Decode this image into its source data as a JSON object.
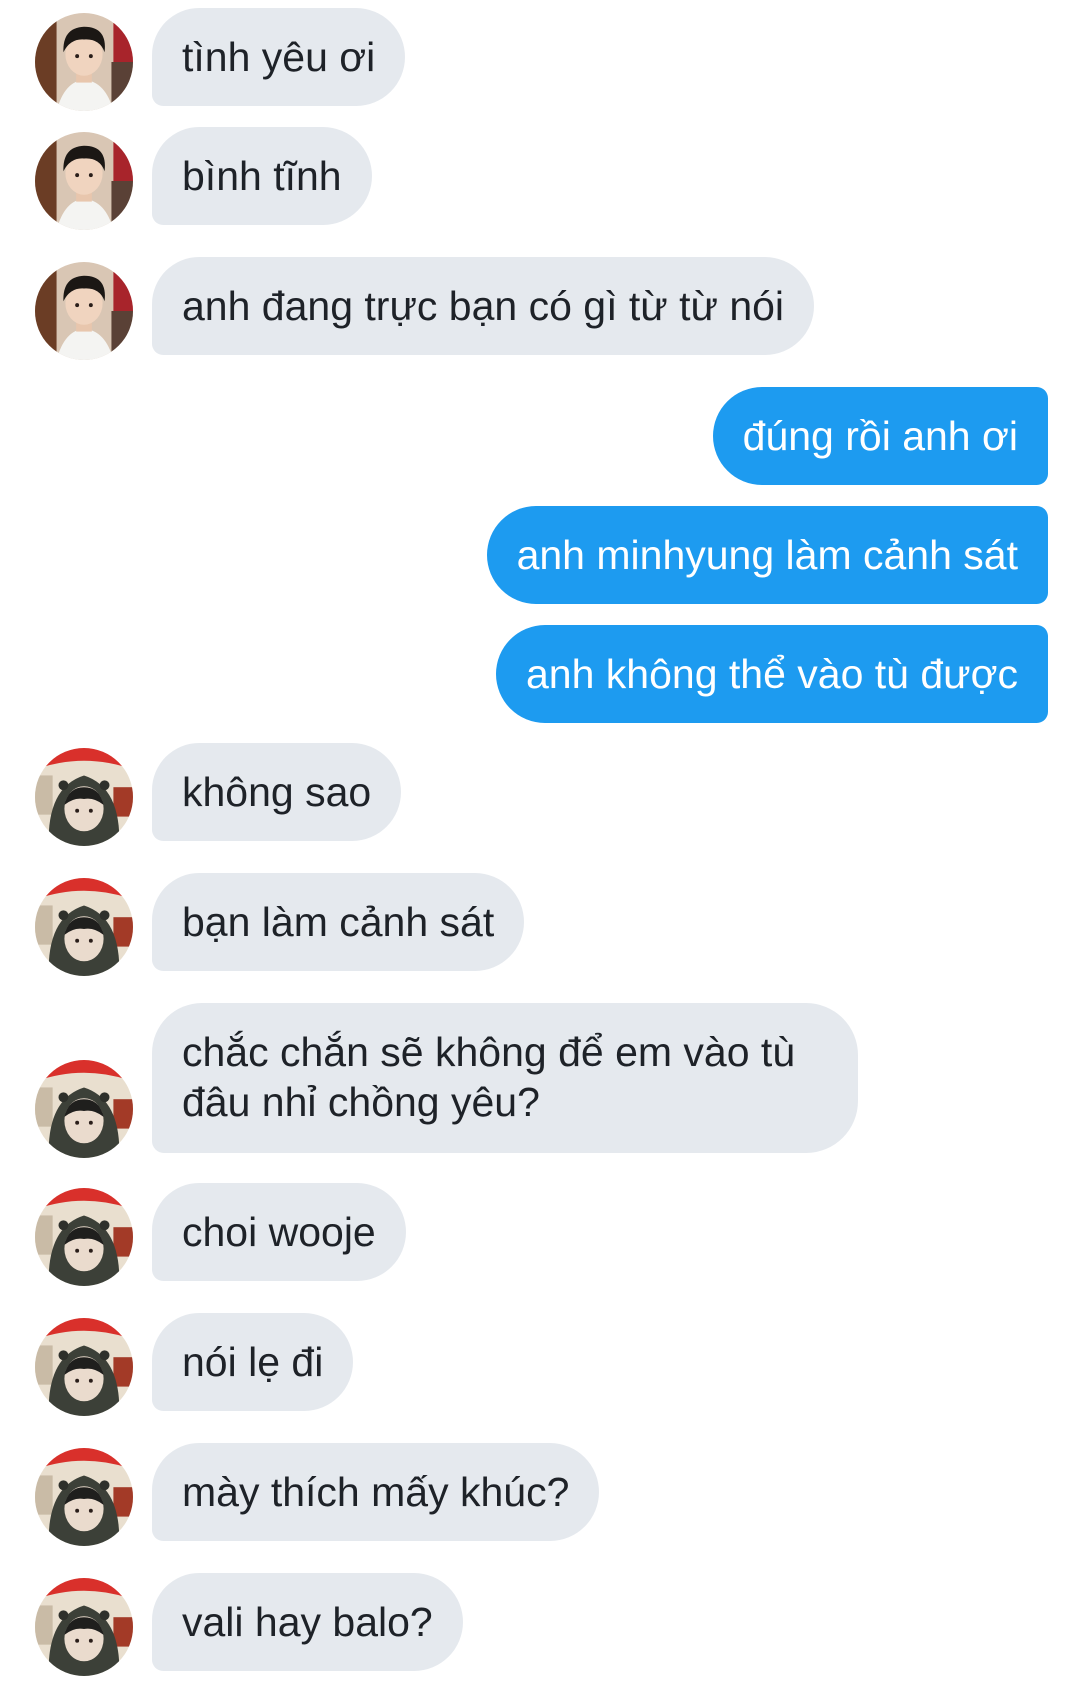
{
  "conversation": {
    "messages": [
      {
        "sender": "minhyung",
        "text": "tình yêu ơi"
      },
      {
        "sender": "minhyung",
        "text": "bình tĩnh"
      },
      {
        "sender": "minhyung",
        "text": "anh đang trực bạn có gì từ từ nói"
      },
      {
        "sender": "me",
        "text": "đúng rồi anh ơi"
      },
      {
        "sender": "me",
        "text": "anh minhyung làm cảnh sát"
      },
      {
        "sender": "me",
        "text": "anh không thể vào tù được"
      },
      {
        "sender": "wooje",
        "text": "không sao"
      },
      {
        "sender": "wooje",
        "text": "bạn làm cảnh sát"
      },
      {
        "sender": "wooje",
        "text": "chắc chắn sẽ không để em vào tù đâu nhỉ chồng yêu?"
      },
      {
        "sender": "wooje",
        "text": "choi wooje"
      },
      {
        "sender": "wooje",
        "text": "nói lẹ đi"
      },
      {
        "sender": "wooje",
        "text": "mày thích mấy khúc?"
      },
      {
        "sender": "wooje",
        "text": "vali hay balo?"
      }
    ]
  },
  "theme": {
    "incoming_bg": "#e5e9ee",
    "incoming_text": "#1e2228",
    "outgoing_bg": "#1d9bf0",
    "outgoing_text": "#ffffff"
  },
  "icons": {
    "avatar_a": "avatar-boy-white-shirt",
    "avatar_b": "avatar-hooded-figure"
  }
}
